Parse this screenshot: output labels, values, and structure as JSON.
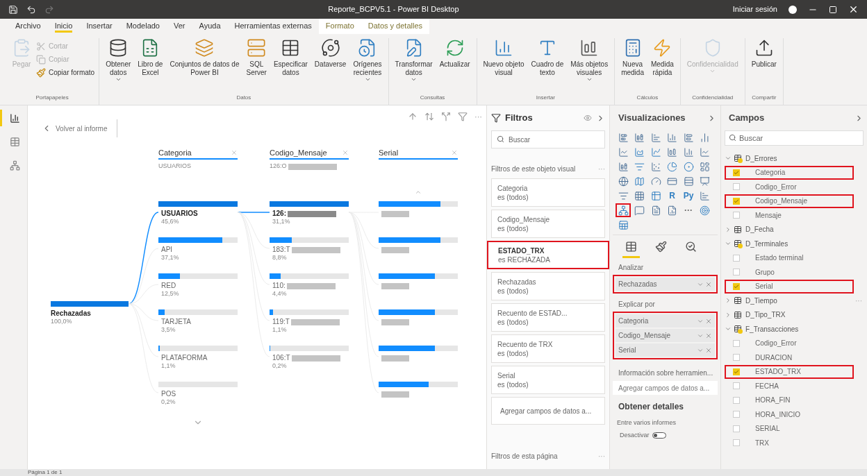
{
  "title_bar": {
    "title": "Reporte_BCPV5.1 - Power BI Desktop",
    "sign_in": "Iniciar sesión"
  },
  "tabs": [
    {
      "label": "Archivo",
      "selected": false,
      "kind": "normal"
    },
    {
      "label": "Inicio",
      "selected": true,
      "kind": "normal"
    },
    {
      "label": "Insertar",
      "selected": false,
      "kind": "normal"
    },
    {
      "label": "Modelado",
      "selected": false,
      "kind": "normal"
    },
    {
      "label": "Ver",
      "selected": false,
      "kind": "normal"
    },
    {
      "label": "Ayuda",
      "selected": false,
      "kind": "normal"
    },
    {
      "label": "Herramientas externas",
      "selected": false,
      "kind": "normal"
    },
    {
      "label": "Formato",
      "selected": false,
      "kind": "contextual"
    },
    {
      "label": "Datos y detalles",
      "selected": false,
      "kind": "contextual"
    }
  ],
  "ribbon": [
    {
      "group": "Portapapeles",
      "buttons": [
        {
          "label": "Pegar",
          "kind": "large",
          "disabled": true,
          "dropdown": false
        },
        {
          "label": "Cortar",
          "kind": "small",
          "disabled": true,
          "dropdown": false
        },
        {
          "label": "Copiar",
          "kind": "small",
          "disabled": true,
          "dropdown": false
        },
        {
          "label": "Copiar formato",
          "kind": "small",
          "disabled": false,
          "dropdown": false
        }
      ]
    },
    {
      "group": "Datos",
      "buttons": [
        {
          "label": "Obtener\ndatos",
          "kind": "large",
          "disabled": false,
          "dropdown": true
        },
        {
          "label": "Libro de\nExcel",
          "kind": "large",
          "disabled": false,
          "dropdown": false
        },
        {
          "label": "Conjuntos de datos de\nPower BI",
          "kind": "large",
          "disabled": false,
          "dropdown": false
        },
        {
          "label": "SQL\nServer",
          "kind": "large",
          "disabled": false,
          "dropdown": false
        },
        {
          "label": "Especificar\ndatos",
          "kind": "large",
          "disabled": false,
          "dropdown": false
        },
        {
          "label": "Dataverse",
          "kind": "large",
          "disabled": false,
          "dropdown": false
        },
        {
          "label": "Orígenes\nrecientes",
          "kind": "large",
          "disabled": false,
          "dropdown": true
        }
      ]
    },
    {
      "group": "Consultas",
      "buttons": [
        {
          "label": "Transformar\ndatos",
          "kind": "large",
          "disabled": false,
          "dropdown": true
        },
        {
          "label": "Actualizar",
          "kind": "large",
          "disabled": false,
          "dropdown": false
        }
      ]
    },
    {
      "group": "Insertar",
      "buttons": [
        {
          "label": "Nuevo objeto\nvisual",
          "kind": "large",
          "disabled": false,
          "dropdown": false
        },
        {
          "label": "Cuadro de\ntexto",
          "kind": "large",
          "disabled": false,
          "dropdown": false
        },
        {
          "label": "Más objetos\nvisuales",
          "kind": "large",
          "disabled": false,
          "dropdown": true
        }
      ]
    },
    {
      "group": "Cálculos",
      "buttons": [
        {
          "label": "Nueva\nmedida",
          "kind": "large",
          "disabled": false,
          "dropdown": false
        },
        {
          "label": "Medida\nrápida",
          "kind": "large",
          "disabled": false,
          "dropdown": false
        }
      ]
    },
    {
      "group": "Confidencialidad",
      "buttons": [
        {
          "label": "Confidencialidad",
          "kind": "large",
          "disabled": true,
          "dropdown": true
        }
      ]
    },
    {
      "group": "Compartir",
      "buttons": [
        {
          "label": "Publicar",
          "kind": "large",
          "disabled": false,
          "dropdown": false
        }
      ]
    }
  ],
  "left_rail": [
    {
      "selected": true
    },
    {
      "selected": false
    },
    {
      "selected": false
    }
  ],
  "canvas": {
    "back": "Volver al informe",
    "more": "···",
    "tree": {
      "root": {
        "label": "Rechazadas",
        "value": "100,0%",
        "level": 1
      },
      "columns": [
        {
          "header": "Categoria",
          "selection": "USUARIOS",
          "scroll_down": true,
          "nodes": [
            {
              "label": "USUARIOS",
              "value": "45,6%",
              "level": 1,
              "selected": true
            },
            {
              "label": "API",
              "value": "37,1%",
              "level": 0.81,
              "selected": false
            },
            {
              "label": "RED",
              "value": "12,5%",
              "level": 0.27,
              "selected": false
            },
            {
              "label": "TARJETA",
              "value": "3,5%",
              "level": 0.08,
              "selected": false
            },
            {
              "label": "PLATAFORMA",
              "value": "1,1%",
              "level": 0.02,
              "selected": false
            },
            {
              "label": "POS",
              "value": "0,2%",
              "level": 0,
              "selected": false
            }
          ]
        },
        {
          "header": "Codigo_Mensaje",
          "selection": "126:O",
          "redacted_selection": true,
          "nodes": [
            {
              "label": "126:",
              "value": "31,1%",
              "level": 1,
              "selected": true,
              "redacted": true
            },
            {
              "label": "183:T",
              "value": "8,8%",
              "level": 0.28,
              "selected": false,
              "redacted": true
            },
            {
              "label": "110:",
              "value": "4,4%",
              "level": 0.14,
              "selected": false,
              "redacted": true
            },
            {
              "label": "119:T",
              "value": "1,1%",
              "level": 0.04,
              "selected": false,
              "redacted": true
            },
            {
              "label": "106:T",
              "value": "0,2%",
              "level": 0.01,
              "selected": false,
              "redacted": true
            }
          ]
        },
        {
          "header": "Serial",
          "scroll_up": true,
          "nodes": [
            {
              "level": 0.78,
              "selected": false,
              "redacted": true
            },
            {
              "level": 0.78,
              "selected": false,
              "redacted": true
            },
            {
              "level": 0.71,
              "selected": false,
              "redacted": true
            },
            {
              "level": 0.71,
              "selected": false,
              "redacted": true
            },
            {
              "level": 0.71,
              "selected": false,
              "redacted": true
            },
            {
              "level": 0.63,
              "selected": false,
              "redacted": true
            }
          ]
        }
      ]
    }
  },
  "filters": {
    "title": "Filtros",
    "search": {
      "placeholder": "Buscar"
    },
    "section": "Filtros de este objeto visual",
    "section_more": "···",
    "cards": [
      {
        "name": "Categoria",
        "value": "es (todos)",
        "highlighted": false
      },
      {
        "name": "Codigo_Mensaje",
        "value": "es (todos)",
        "highlighted": false
      },
      {
        "name": "ESTADO_TRX",
        "value": "es RECHAZADA",
        "highlighted": true
      },
      {
        "name": "Rechazadas",
        "value": "es (todos)",
        "highlighted": false
      },
      {
        "name": "Recuento de ESTAD...",
        "value": "es (todos)",
        "highlighted": false
      },
      {
        "name": "Recuento de TRX",
        "value": "es (todos)",
        "highlighted": false
      },
      {
        "name": "Serial",
        "value": "es (todos)",
        "highlighted": false
      }
    ],
    "drop_zone": "Agregar campos de datos a...",
    "page_section": "Filtros de esta página",
    "page_more": "···"
  },
  "visualizations": {
    "title": "Visualizaciones",
    "icons": [
      {
        "selected": false
      },
      {
        "selected": false
      },
      {
        "selected": false
      },
      {
        "selected": false
      },
      {
        "selected": false
      },
      {
        "selected": false
      },
      {
        "selected": false
      },
      {
        "selected": false
      },
      {
        "selected": false
      },
      {
        "selected": false
      },
      {
        "selected": false
      },
      {
        "selected": false
      },
      {
        "selected": false
      },
      {
        "selected": false
      },
      {
        "selected": false
      },
      {
        "selected": false
      },
      {
        "selected": false
      },
      {
        "selected": false
      },
      {
        "selected": false
      },
      {
        "selected": false
      },
      {
        "selected": false
      },
      {
        "selected": false
      },
      {
        "selected": false
      },
      {
        "selected": false
      },
      {
        "selected": false
      },
      {
        "selected": false
      },
      {
        "selected": false
      },
      {
        "glyph": "R",
        "selected": false
      },
      {
        "glyph": "Py",
        "selected": false
      },
      {
        "selected": false
      },
      {
        "selected": true
      },
      {
        "selected": false
      },
      {
        "selected": false
      },
      {
        "selected": false
      },
      {
        "glyph": "···",
        "selected": false
      },
      {
        "selected": false
      },
      {
        "selected": false
      }
    ],
    "pane_tabs": [
      {
        "selected": true
      },
      {
        "selected": false
      },
      {
        "selected": false
      }
    ],
    "analyze_label": "Analizar",
    "analyze": [
      {
        "label": "Rechazadas"
      }
    ],
    "analyze_highlighted": true,
    "explain_label": "Explicar por",
    "explain": [
      {
        "label": "Categoria"
      },
      {
        "label": "Codigo_Mensaje"
      },
      {
        "label": "Serial"
      }
    ],
    "explain_highlighted": true,
    "tooltip_label": "Información sobre herramien...",
    "tooltip_drop": "Agregar campos de datos a...",
    "drill_title": "Obtener detalles",
    "drill_sub": "Entre varios informes",
    "drill_toggle": {
      "label": "Desactivar",
      "on": false
    }
  },
  "fields": {
    "title": "Campos",
    "search": {
      "placeholder": "Buscar"
    },
    "tables": [
      {
        "name": "D_Errores",
        "expanded": true,
        "has_checked": true,
        "children": [
          {
            "name": "Categoria",
            "checked": true,
            "highlighted": true
          },
          {
            "name": "Codigo_Error",
            "checked": false,
            "highlighted": false
          },
          {
            "name": "Codigo_Mensaje",
            "checked": true,
            "highlighted": true
          },
          {
            "name": "Mensaje",
            "checked": false,
            "highlighted": false
          }
        ]
      },
      {
        "name": "D_Fecha",
        "expanded": false,
        "has_checked": false
      },
      {
        "name": "D_Terminales",
        "expanded": true,
        "has_checked": true,
        "children": [
          {
            "name": "Estado terminal",
            "checked": false,
            "highlighted": false
          },
          {
            "name": "Grupo",
            "checked": false,
            "highlighted": false
          },
          {
            "name": "Serial",
            "checked": true,
            "highlighted": true
          }
        ]
      },
      {
        "name": "D_Tiempo",
        "expanded": false,
        "has_checked": false,
        "more": "···"
      },
      {
        "name": "D_Tipo_TRX",
        "expanded": false,
        "has_checked": false
      },
      {
        "name": "F_Transacciones",
        "expanded": true,
        "has_checked": true,
        "children": [
          {
            "name": "Codigo_Error",
            "checked": false,
            "highlighted": false
          },
          {
            "name": "DURACION",
            "checked": false,
            "highlighted": false
          },
          {
            "name": "ESTADO_TRX",
            "checked": true,
            "highlighted": true
          },
          {
            "name": "FECHA",
            "checked": false,
            "highlighted": false
          },
          {
            "name": "HORA_FIN",
            "checked": false,
            "highlighted": false
          },
          {
            "name": "HORA_INICIO",
            "checked": false,
            "highlighted": false
          },
          {
            "name": "SERIAL",
            "checked": false,
            "highlighted": false
          },
          {
            "name": "TRX",
            "checked": false,
            "highlighted": false
          }
        ]
      }
    ]
  },
  "status_bar": {
    "page": "Página 1 de 1"
  }
}
